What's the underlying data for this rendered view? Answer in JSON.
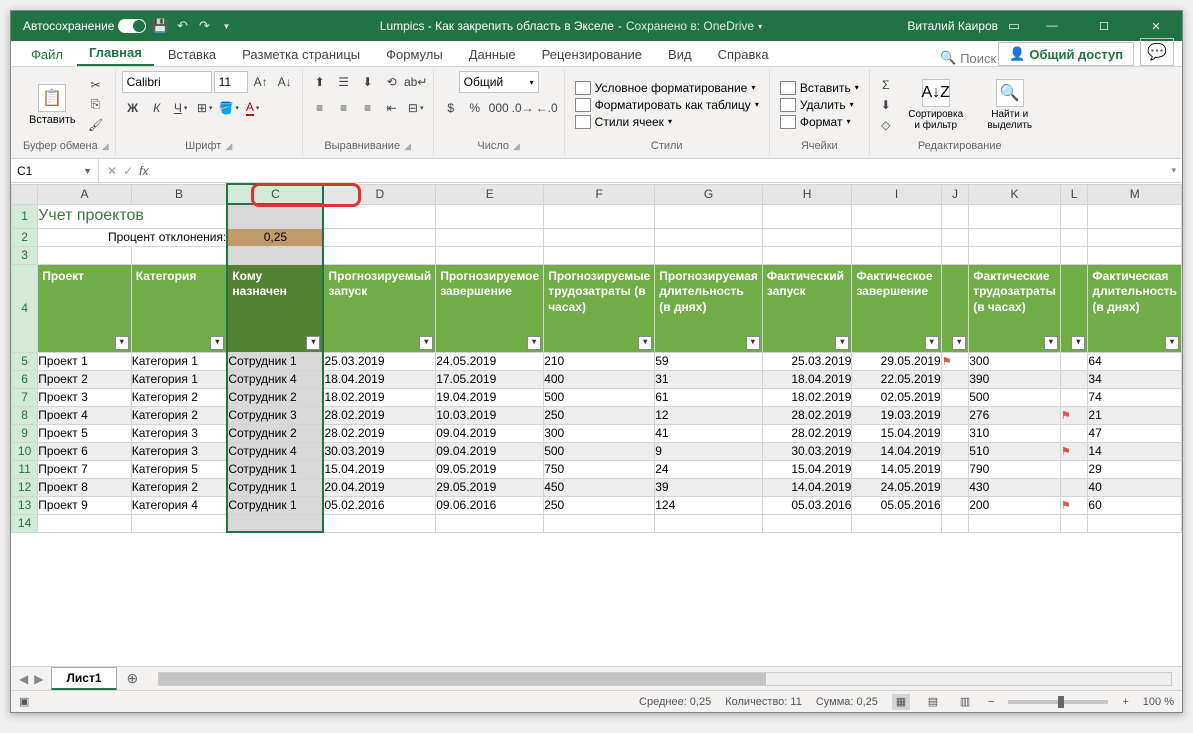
{
  "titlebar": {
    "autosave": "Автосохранение",
    "doc": "Lumpics - Как закрепить область в Экселе",
    "saved": "Сохранено в: OneDrive",
    "user": "Виталий Каиров"
  },
  "tabs": {
    "file": "Файл",
    "home": "Главная",
    "insert": "Вставка",
    "layout": "Разметка страницы",
    "formulas": "Формулы",
    "data": "Данные",
    "review": "Рецензирование",
    "view": "Вид",
    "help": "Справка",
    "search": "Поиск",
    "share": "Общий доступ"
  },
  "ribbon": {
    "paste": "Вставить",
    "clipboard": "Буфер обмена",
    "font": "Шрифт",
    "fontname": "Calibri",
    "fontsize": "11",
    "alignment": "Выравнивание",
    "number": "Число",
    "numfmt": "Общий",
    "styles": "Стили",
    "cond": "Условное форматирование",
    "fmttable": "Форматировать как таблицу",
    "cellstyles": "Стили ячеек",
    "cells": "Ячейки",
    "ins": "Вставить",
    "del": "Удалить",
    "fmt": "Формат",
    "editing": "Редактирование",
    "sort": "Сортировка и фильтр",
    "find": "Найти и выделить"
  },
  "namebox": "C1",
  "cols": [
    "",
    "A",
    "B",
    "C",
    "D",
    "E",
    "F",
    "G",
    "H",
    "I",
    "J",
    "K",
    "L",
    "M"
  ],
  "rows": [
    "1",
    "2",
    "3",
    "4",
    "5",
    "6",
    "7",
    "8",
    "9",
    "10",
    "11",
    "12",
    "13",
    "14"
  ],
  "sheet": {
    "title": "Учет проектов",
    "devlabel": "Процент отклонения:",
    "devval": "0,25",
    "hdr": [
      "Проект",
      "Категория",
      "Кому назначен",
      "Прогнозируемый запуск",
      "Прогнозируемое завершение",
      "Прогнозируемые трудозатраты (в часах)",
      "Прогнозируемая длительность (в днях)",
      "Фактический запуск",
      "Фактическое завершение",
      "",
      "Фактические трудозатраты (в часах)",
      "",
      "Фактическая длительность (в днях)"
    ],
    "data": [
      [
        "Проект 1",
        "Категория 1",
        "Сотрудник 1",
        "25.03.2019",
        "24.05.2019",
        "210",
        "59",
        "25.03.2019",
        "29.05.2019",
        "flag",
        "300",
        "",
        "64"
      ],
      [
        "Проект 2",
        "Категория 1",
        "Сотрудник 4",
        "18.04.2019",
        "17.05.2019",
        "400",
        "31",
        "18.04.2019",
        "22.05.2019",
        "",
        "390",
        "",
        "34"
      ],
      [
        "Проект 3",
        "Категория 2",
        "Сотрудник 2",
        "18.02.2019",
        "19.04.2019",
        "500",
        "61",
        "18.02.2019",
        "02.05.2019",
        "",
        "500",
        "",
        "74"
      ],
      [
        "Проект 4",
        "Категория 2",
        "Сотрудник 3",
        "28.02.2019",
        "10.03.2019",
        "250",
        "12",
        "28.02.2019",
        "19.03.2019",
        "",
        "276",
        "flag",
        "21"
      ],
      [
        "Проект 5",
        "Категория 3",
        "Сотрудник 2",
        "28.02.2019",
        "09.04.2019",
        "300",
        "41",
        "28.02.2019",
        "15.04.2019",
        "",
        "310",
        "",
        "47"
      ],
      [
        "Проект 6",
        "Категория 3",
        "Сотрудник 4",
        "30.03.2019",
        "09.04.2019",
        "500",
        "9",
        "30.03.2019",
        "14.04.2019",
        "",
        "510",
        "flag",
        "14"
      ],
      [
        "Проект 7",
        "Категория 5",
        "Сотрудник 1",
        "15.04.2019",
        "09.05.2019",
        "750",
        "24",
        "15.04.2019",
        "14.05.2019",
        "",
        "790",
        "",
        "29"
      ],
      [
        "Проект 8",
        "Категория 2",
        "Сотрудник 1",
        "20.04.2019",
        "29.05.2019",
        "450",
        "39",
        "14.04.2019",
        "24.05.2019",
        "",
        "430",
        "",
        "40"
      ],
      [
        "Проект 9",
        "Категория 4",
        "Сотрудник 1",
        "05.02.2016",
        "09.06.2016",
        "250",
        "124",
        "05.03.2016",
        "05.05.2016",
        "",
        "200",
        "flag",
        "60"
      ]
    ]
  },
  "sheettab": "Лист1",
  "status": {
    "avg": "Среднее: 0,25",
    "count": "Количество: 11",
    "sum": "Сумма: 0,25",
    "zoom": "100 %"
  }
}
